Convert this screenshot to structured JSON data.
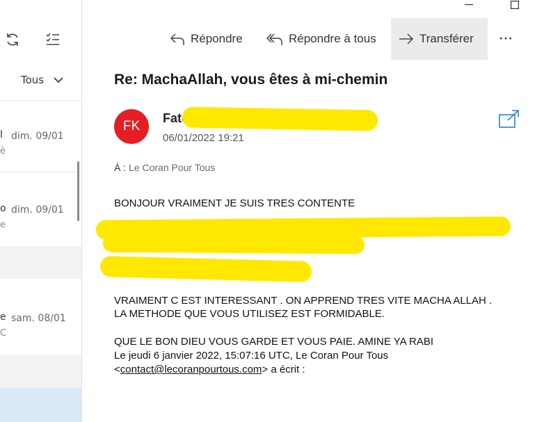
{
  "window": {
    "minimize": "minimize",
    "maximize": "maximize"
  },
  "left_pane": {
    "filter_label": "Tous",
    "items": [
      {
        "edge_top": "l",
        "edge_bottom": "è",
        "date": "dim. 09/01"
      },
      {
        "edge_top": "o",
        "edge_bottom": "e",
        "date": "dim. 09/01"
      },
      {
        "edge_top": "e",
        "edge_bottom": "C",
        "date": "sam. 08/01"
      }
    ]
  },
  "toolbar": {
    "reply": "Répondre",
    "reply_all": "Répondre à tous",
    "forward": "Transférer",
    "more": "···"
  },
  "message": {
    "subject": "Re: MachaAllah, vous êtes à mi-chemin",
    "avatar_initials": "FK",
    "sender_visible": "Fato",
    "date": "06/01/2022 19:21",
    "to_label": "À :",
    "to_value": "Le Coran Pour Tous",
    "body": {
      "line1": "BONJOUR VRAIMENT JE SUIS TRES CONTENTE",
      "line2": "VRAIMENT C EST INTERESSANT . ON APPREND TRES VITE MACHA ALLAH .",
      "line3": "LA METHODE QUE VOUS UTILISEZ EST FORMIDABLE.",
      "line4": "QUE LE BON DIEU VOUS GARDE ET VOUS PAIE. AMINE YA RABI",
      "line5": "Le jeudi 6 janvier 2022, 15:07:16 UTC, Le Coran Pour Tous",
      "quote_prefix": "<",
      "quote_email": "contact@lecoranpourtous.com",
      "quote_suffix": "> a écrit :"
    }
  },
  "colors": {
    "avatar_bg": "#e61e23",
    "accent": "#2b7fd4",
    "highlight": "#ffe800"
  }
}
